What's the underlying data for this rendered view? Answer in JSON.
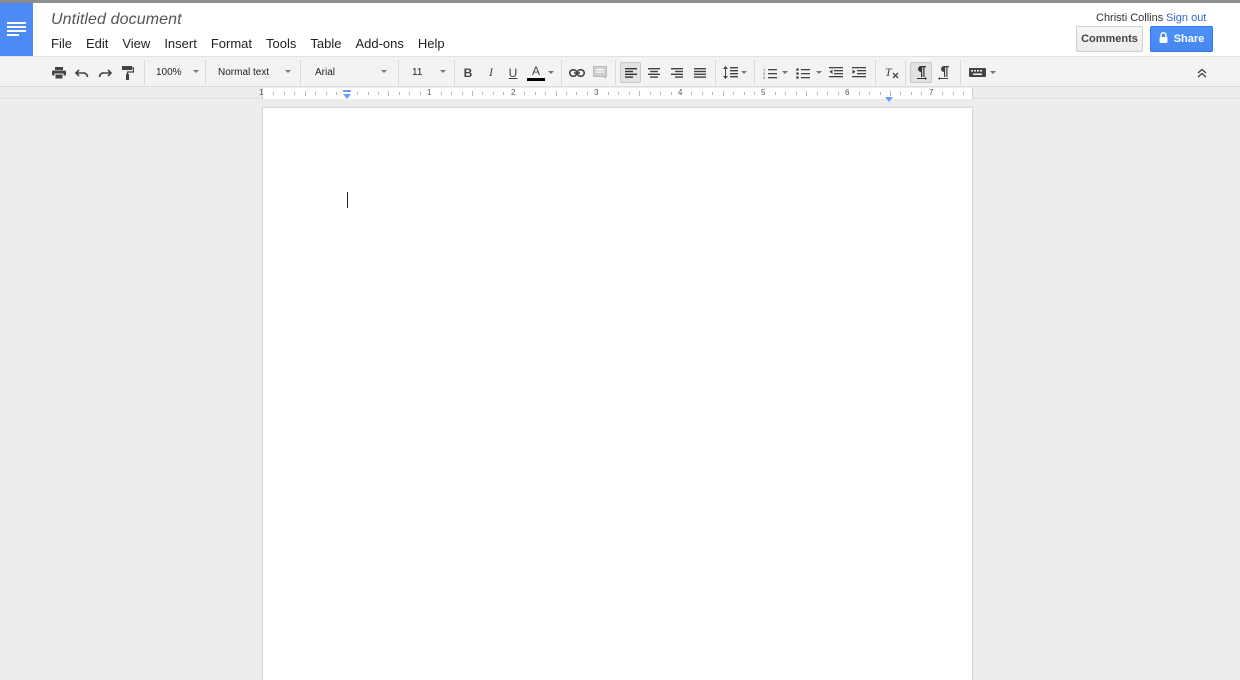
{
  "document": {
    "title": "Untitled document"
  },
  "menu": [
    "File",
    "Edit",
    "View",
    "Insert",
    "Format",
    "Tools",
    "Table",
    "Add-ons",
    "Help"
  ],
  "account": {
    "user_name": "Christi Collins",
    "sign_out": "Sign out"
  },
  "buttons": {
    "comments": "Comments",
    "share": "Share"
  },
  "toolbar": {
    "zoom": "100%",
    "style": "Normal text",
    "font": "Arial",
    "font_size": "11",
    "bold": "B",
    "italic": "I",
    "underline": "U",
    "text_color_letter": "A"
  },
  "ruler": {
    "labels": [
      "1",
      "1",
      "2",
      "3",
      "4",
      "5",
      "6",
      "7"
    ]
  },
  "colors": {
    "accent_blue": "#4c8bf5",
    "share_blue": "#4d90fe",
    "link_blue": "#3366cc"
  }
}
